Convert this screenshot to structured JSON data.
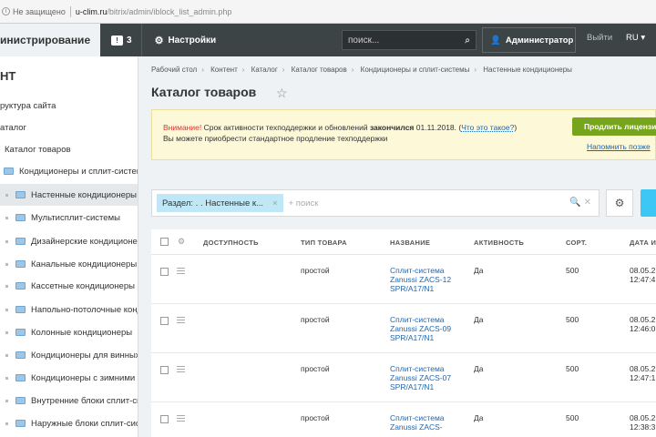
{
  "browser": {
    "security_label": "Не защищено",
    "url_host": "u-clim.ru",
    "url_path": "/bitrix/admin/iblock_list_admin.php"
  },
  "topbar": {
    "brand": "инистрирование",
    "notifications_count": "3",
    "settings_label": "Настройки",
    "search_placeholder": "поиск...",
    "admin_label": "Администратор",
    "logout_label": "Выйти",
    "lang_label": "RU"
  },
  "sidebar": {
    "title": "НТ",
    "items": [
      {
        "label": "руктура сайта"
      },
      {
        "label": "аталог"
      },
      {
        "label": "Каталог товаров"
      },
      {
        "label": "Кондиционеры и сплит-системы"
      },
      {
        "label": "Настенные кондиционеры"
      },
      {
        "label": "Мультисплит-системы"
      },
      {
        "label": "Дизайнерские кондиционеры"
      },
      {
        "label": "Канальные кондиционеры"
      },
      {
        "label": "Кассетные кондиционеры"
      },
      {
        "label": "Напольно-потолочные кондиционеры"
      },
      {
        "label": "Колонные кондиционеры"
      },
      {
        "label": "Кондиционеры для винных"
      },
      {
        "label": "Кондиционеры с зимними"
      },
      {
        "label": "Внутренние блоки сплит-систем"
      },
      {
        "label": "Наружные блоки сплит-систем"
      }
    ]
  },
  "breadcrumbs": [
    "Рабочий стол",
    "Контент",
    "Каталог",
    "Каталог товаров",
    "Кондиционеры и сплит-системы",
    "Настенные кондиционеры"
  ],
  "page_title": "Каталог товаров",
  "warning": {
    "attention": "Внимание!",
    "text1": " Срок активности техподдержки и обновлений ",
    "expired": "закончился",
    "date": " 01.11.2018. (",
    "link": "Что это такое?",
    "close": ")",
    "line2": "Вы можете приобрести стандартное продление техподдержки",
    "buy_button": "Продлить лицензию",
    "remind_later": "Напомнить позже"
  },
  "filter": {
    "chip_label": "Раздел: . . Настенные к...",
    "chip_close": "×",
    "search_placeholder": "+ поиск",
    "right_icons": "🔍 ✕"
  },
  "grid": {
    "columns": [
      "ДОСТУПНОСТЬ",
      "ТИП ТОВАРА",
      "НАЗВАНИЕ",
      "АКТИВНОСТЬ",
      "СОРТ.",
      "ДАТА И"
    ],
    "rows": [
      {
        "type": "простой",
        "name": "Сплит-система Zanussi ZACS-12 SPR/A17/N1",
        "active": "Да",
        "sort": "500",
        "date1": "08.05.2",
        "date2": "12:47:4"
      },
      {
        "type": "простой",
        "name": "Сплит-система Zanussi ZACS-09 SPR/A17/N1",
        "active": "Да",
        "sort": "500",
        "date1": "08.05.2",
        "date2": "12:46:0"
      },
      {
        "type": "простой",
        "name": "Сплит-система Zanussi ZACS-07 SPR/A17/N1",
        "active": "Да",
        "sort": "500",
        "date1": "08.05.2",
        "date2": "12:47:1"
      },
      {
        "type": "простой",
        "name": "Сплит-система Zanussi ZACS-",
        "active": "Да",
        "sort": "500",
        "date1": "08.05.2",
        "date2": "12:38:3"
      }
    ]
  },
  "colors": {
    "topbar_bg": "#3c4446",
    "accent_green": "#76a41c",
    "link_blue": "#2067b0",
    "chip_bg": "#bfe7f5",
    "add_button": "#3bc8f5",
    "warning_bg": "#fdf8d8"
  }
}
